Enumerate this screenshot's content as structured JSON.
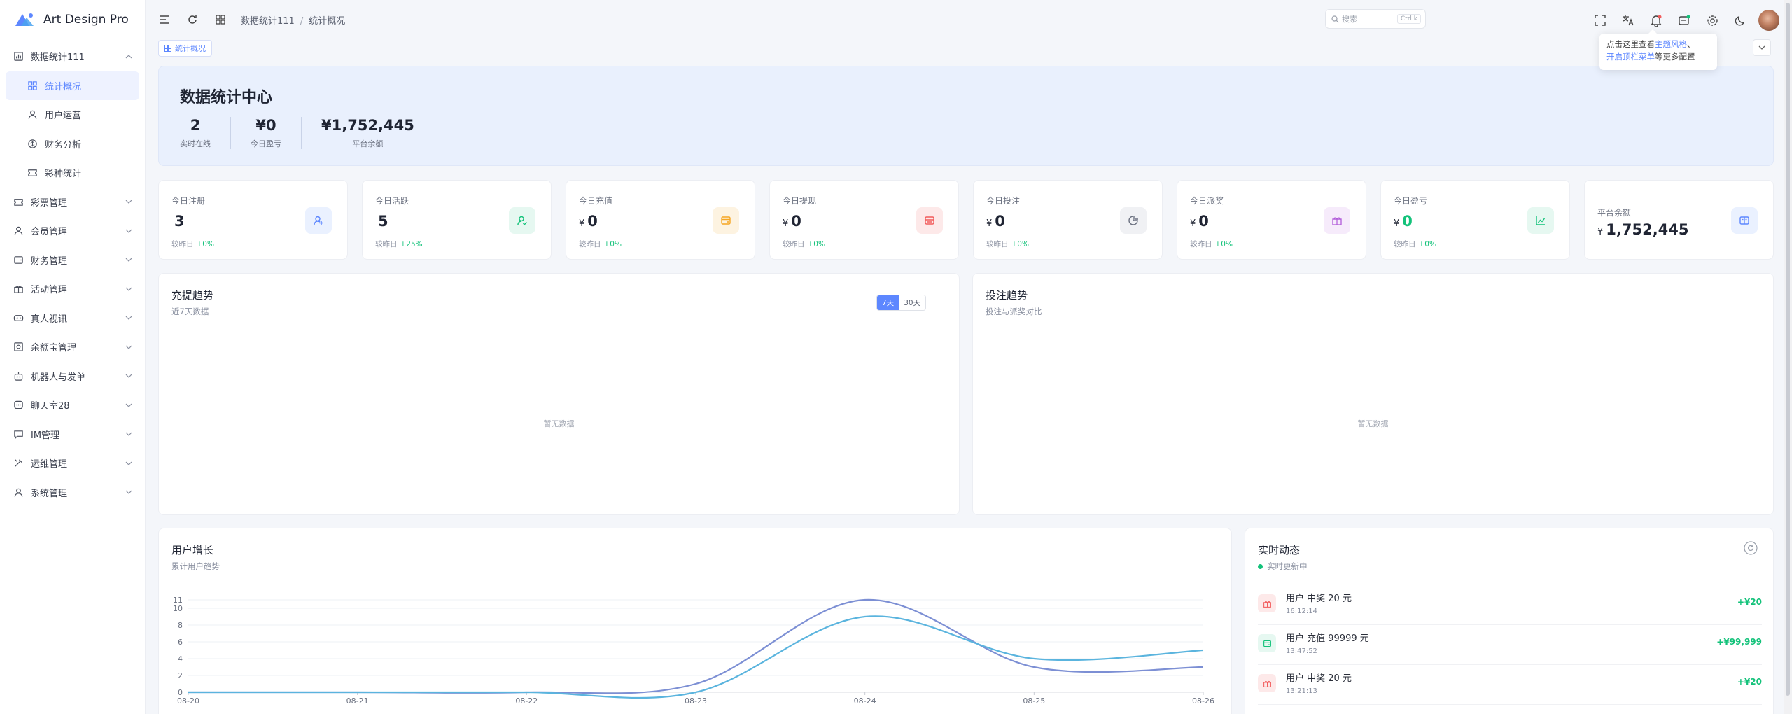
{
  "app": {
    "name": "Art Design Pro"
  },
  "sidebar": {
    "items": [
      {
        "label": "数据统计111",
        "icon": "dashboard-icon",
        "expanded": true
      },
      {
        "label": "统计概况",
        "icon": "grid-icon",
        "sub": true,
        "active": true
      },
      {
        "label": "用户运营",
        "icon": "user-icon",
        "sub": true
      },
      {
        "label": "财务分析",
        "icon": "coin-icon",
        "sub": true
      },
      {
        "label": "彩种统计",
        "icon": "ticket-icon",
        "sub": true
      },
      {
        "label": "彩票管理",
        "icon": "ticket-icon"
      },
      {
        "label": "会员管理",
        "icon": "user-icon"
      },
      {
        "label": "财务管理",
        "icon": "wallet-icon"
      },
      {
        "label": "活动管理",
        "icon": "gift-icon"
      },
      {
        "label": "真人视讯",
        "icon": "gamepad-icon"
      },
      {
        "label": "余额宝管理",
        "icon": "safe-icon"
      },
      {
        "label": "机器人与发单",
        "icon": "robot-icon"
      },
      {
        "label": "聊天室28",
        "icon": "chat-icon"
      },
      {
        "label": "IM管理",
        "icon": "message-icon"
      },
      {
        "label": "运维管理",
        "icon": "tools-icon"
      },
      {
        "label": "系统管理",
        "icon": "user-icon"
      }
    ]
  },
  "header": {
    "breadcrumb": [
      "数据统计111",
      "统计概况"
    ],
    "search_placeholder": "搜索",
    "search_kbd": "Ctrl k"
  },
  "tabs": [
    {
      "label": "统计概况"
    }
  ],
  "tooltip": {
    "line1_pre": "点击这里查看",
    "line1_link": "主题风格",
    "line1_post": "、",
    "line2_link": "开启顶栏菜单",
    "line2_post": "等更多配置"
  },
  "hero": {
    "title": "数据统计中心",
    "stats": [
      {
        "value": "2",
        "label": "实时在线"
      },
      {
        "value": "¥0",
        "label": "今日盈亏"
      },
      {
        "value": "¥1,752,445",
        "label": "平台余额"
      }
    ]
  },
  "stat_cards": [
    {
      "title": "今日注册",
      "currency": "",
      "value": "3",
      "compare_label": "较昨日",
      "change": "+0%",
      "icon": "user-add-icon",
      "color": "#5d87ff",
      "bg": "#eaf1ff",
      "value_color": "#1f2433"
    },
    {
      "title": "今日活跃",
      "currency": "",
      "value": "5",
      "compare_label": "较昨日",
      "change": "+25%",
      "icon": "user-check-icon",
      "color": "#13c27a",
      "bg": "#e6f8f1",
      "value_color": "#1f2433"
    },
    {
      "title": "今日充值",
      "currency": "¥",
      "value": "0",
      "compare_label": "较昨日",
      "change": "+0%",
      "icon": "recharge-icon",
      "color": "#f5a623",
      "bg": "#fdf3e1",
      "value_color": "#1f2433"
    },
    {
      "title": "今日提现",
      "currency": "¥",
      "value": "0",
      "compare_label": "较昨日",
      "change": "+0%",
      "icon": "withdraw-icon",
      "color": "#f25c5c",
      "bg": "#fde9e9",
      "value_color": "#1f2433"
    },
    {
      "title": "今日投注",
      "currency": "¥",
      "value": "0",
      "compare_label": "较昨日",
      "change": "+0%",
      "icon": "pie-icon",
      "color": "#6b7180",
      "bg": "#f0f1f4",
      "value_color": "#1f2433"
    },
    {
      "title": "今日派奖",
      "currency": "¥",
      "value": "0",
      "compare_label": "较昨日",
      "change": "+0%",
      "icon": "gift-icon",
      "color": "#b15ad9",
      "bg": "#f6ebfb",
      "value_color": "#1f2433"
    },
    {
      "title": "今日盈亏",
      "currency": "¥",
      "value": "0",
      "compare_label": "较昨日",
      "change": "+0%",
      "icon": "trend-icon",
      "color": "#13c27a",
      "bg": "#e6f8f1",
      "value_color": "#13c27a"
    },
    {
      "title": "平台余额",
      "currency": "¥",
      "value": "1,752,445",
      "compare_label": "",
      "change": "",
      "icon": "book-icon",
      "color": "#5d87ff",
      "bg": "#eaf1ff",
      "value_color": "#1f2433"
    }
  ],
  "panels": {
    "recharge": {
      "title": "充提趋势",
      "subtitle": "近7天数据",
      "seg": [
        "7天",
        "30天"
      ],
      "empty": "暂无数据"
    },
    "bet": {
      "title": "投注趋势",
      "subtitle": "投注与派奖对比",
      "empty": "暂无数据"
    },
    "growth": {
      "title": "用户增长",
      "subtitle": "累计用户趋势"
    },
    "feed": {
      "title": "实时动态",
      "status": "实时更新中",
      "items": [
        {
          "text": "用户 中奖 20 元",
          "time": "16:12:14",
          "amount": "+¥20",
          "icon": "gift-icon",
          "color": "#f25c5c",
          "bg": "#fde9e9"
        },
        {
          "text": "用户 充值 99999 元",
          "time": "13:47:52",
          "amount": "+¥99,999",
          "icon": "recharge-icon",
          "color": "#13c27a",
          "bg": "#e6f8f1"
        },
        {
          "text": "用户 中奖 20 元",
          "time": "13:21:13",
          "amount": "+¥20",
          "icon": "gift-icon",
          "color": "#f25c5c",
          "bg": "#fde9e9"
        }
      ]
    }
  },
  "chart_data": {
    "type": "line",
    "x": [
      "08-20",
      "08-21",
      "08-22",
      "08-23",
      "08-24",
      "08-25",
      "08-26"
    ],
    "series": [
      {
        "values": [
          0,
          0,
          0,
          1,
          11,
          3,
          3
        ],
        "color": "#7c8fd4"
      },
      {
        "values": [
          0,
          0,
          0,
          0,
          9,
          4,
          5
        ],
        "color": "#5ab4de"
      }
    ],
    "yticks": [
      0,
      2,
      4,
      6,
      8,
      10,
      11
    ],
    "ylim": [
      0,
      11
    ],
    "grid": true
  }
}
